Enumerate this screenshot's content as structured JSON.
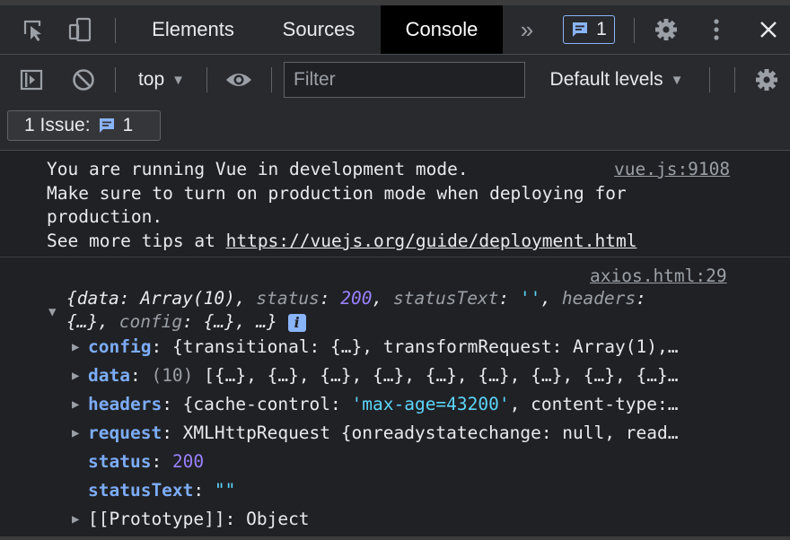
{
  "tabs": {
    "elements": "Elements",
    "sources": "Sources",
    "console": "Console",
    "more": "»",
    "issue_count": "1"
  },
  "filterbar": {
    "context": "top",
    "context_arrow": "▼",
    "filter_placeholder": "Filter",
    "levels": "Default levels",
    "levels_arrow": "▼"
  },
  "issues": {
    "label": "1 Issue:",
    "count": "1"
  },
  "messages": [
    {
      "lines": [
        "You are running Vue in development mode.",
        "Make sure to turn on production mode when deploying for",
        "production.",
        "See more tips at "
      ],
      "tips_url": "https://vuejs.org/guide/deployment.html",
      "source": "vue.js:9108"
    },
    {
      "source": "axios.html:29",
      "summary_line1": {
        "k1": "data",
        "v1": "Array(10)",
        "k2": "status",
        "v2": "200",
        "k3": "statusText",
        "v3": "''",
        "k4": "headers"
      },
      "summary_line2": {
        "v4": "{…}",
        "k5": "config",
        "v5": "{…}",
        "rest": "…"
      },
      "props": [
        {
          "key": "config",
          "value": "{transitional: {…}, transformRequest: Array(1),…"
        },
        {
          "key": "data",
          "count": "(10)",
          "value": "[{…}, {…}, {…}, {…}, {…}, {…}, {…}, {…}, {…}…"
        },
        {
          "key": "headers",
          "prefix": "{cache-control: ",
          "str": "'max-age=43200'",
          "suffix": ", content-type:…"
        },
        {
          "key": "request",
          "value": "XMLHttpRequest {onreadystatechange: null, read…"
        },
        {
          "key": "status",
          "value": "200"
        },
        {
          "key": "statusText",
          "value": "\"\""
        },
        {
          "key": "[[Prototype]]",
          "value": "Object"
        }
      ]
    }
  ],
  "colors": {
    "background": "#202124",
    "toolbar": "#292a2d",
    "accent": "#8ab4f8",
    "key": "#7cacf8",
    "number": "#9980ff",
    "string": "#5cd5fb"
  }
}
